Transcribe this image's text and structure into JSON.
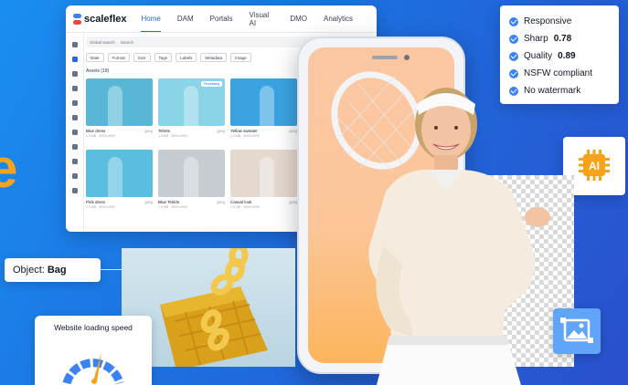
{
  "dam": {
    "logo": "scaleflex",
    "nav": [
      "Home",
      "DAM",
      "Portals",
      "Visual AI",
      "DMO",
      "Analytics"
    ],
    "active_nav": "Home",
    "search_scope": "Global search",
    "search_placeholder": "Search",
    "filters": [
      "Date",
      "Format",
      "Size",
      "Tags",
      "Labels",
      "Metadata",
      "Image"
    ],
    "assets_title": "Assets (18)",
    "assets": [
      {
        "name": "Blue dress",
        "ext": "jpeg",
        "meta": "1.9 MB · 3000×4000",
        "color": "#58b7d4"
      },
      {
        "name": "Tshirts",
        "ext": "jpeg",
        "meta": "1.9 MB · 3000×4000",
        "color": "#8bd3e6",
        "badge": "Processing"
      },
      {
        "name": "Yellow sweater",
        "ext": "jpeg",
        "meta": "1.9 MB · 3000×4000",
        "color": "#3aa3e0"
      },
      {
        "name": "Pink dress",
        "ext": "jpeg",
        "meta": "1.9 MB · 3000×4000",
        "color": "#5bbde0"
      },
      {
        "name": "Blue Tshirts",
        "ext": "jpeg",
        "meta": "1.9 MB · 3000×4000",
        "color": "#c7ccd3"
      },
      {
        "name": "Casual look",
        "ext": "jpeg",
        "meta": "1.9 MB · 3000×4000",
        "color": "#e5d9cf"
      }
    ]
  },
  "specs": [
    {
      "label": "Responsive",
      "value": ""
    },
    {
      "label": "Sharp",
      "value": "0.78"
    },
    {
      "label": "Quality",
      "value": "0.89"
    },
    {
      "label": "NSFW compliant",
      "value": ""
    },
    {
      "label": "No watermark",
      "value": ""
    }
  ],
  "object_label": {
    "key": "Object:",
    "value": "Bag"
  },
  "speed_card": {
    "title": "Website loading speed"
  },
  "ai_badge": {
    "text": "AI"
  },
  "edge_letter": "e",
  "colors": {
    "accent": "#2563eb",
    "orange": "#f7a21b",
    "check": "#3b82f6"
  }
}
